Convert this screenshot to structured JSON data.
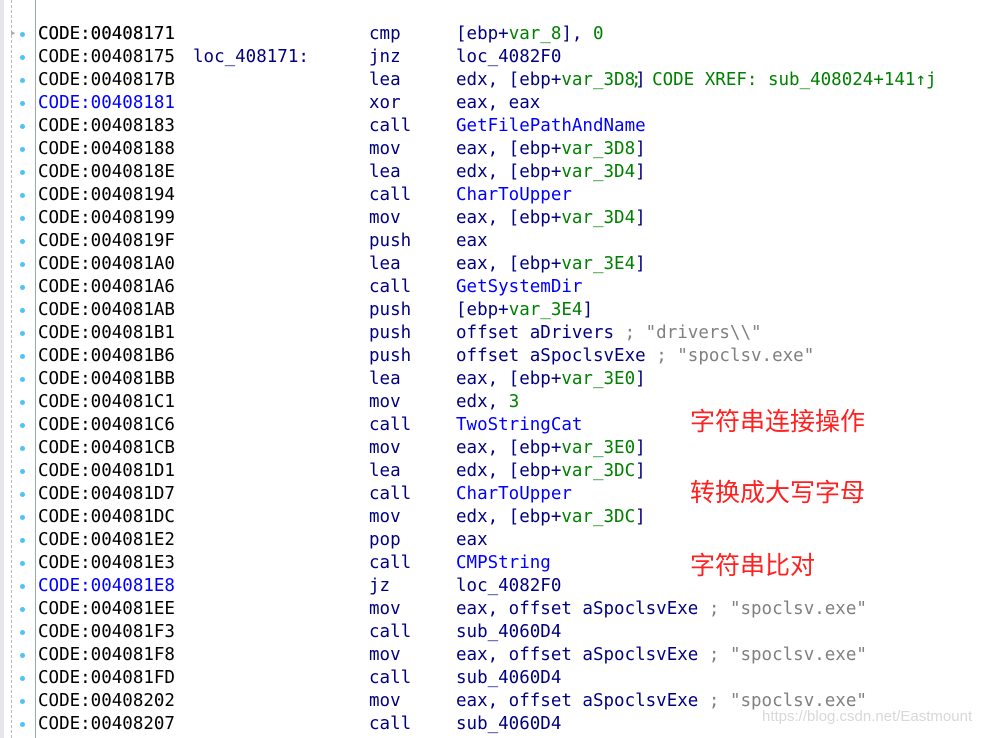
{
  "header": {
    "address": "CODE:00408171",
    "label": "loc_408171:",
    "xref": "; CODE XREF: sub_408024+141↑j"
  },
  "rows": [
    {
      "a": "CODE:00408171",
      "m": "cmp",
      "o": [
        [
          "",
          "[ebp+"
        ],
        [
          "var",
          "var_8"
        ],
        [
          "",
          "], "
        ],
        [
          "num",
          "0"
        ]
      ]
    },
    {
      "a": "CODE:00408175",
      "m": "jnz",
      "o": [
        [
          "",
          "loc_4082F0"
        ]
      ]
    },
    {
      "a": "CODE:0040817B",
      "m": "lea",
      "o": [
        [
          "",
          "edx, [ebp+"
        ],
        [
          "var",
          "var_3D8"
        ],
        [
          "",
          "]"
        ]
      ]
    },
    {
      "a": "CODE:00408181",
      "blue": true,
      "m": "xor",
      "o": [
        [
          "",
          "eax, eax"
        ]
      ]
    },
    {
      "a": "CODE:00408183",
      "m": "call",
      "o": [
        [
          "func",
          "GetFilePathAndName"
        ]
      ]
    },
    {
      "a": "CODE:00408188",
      "m": "mov",
      "o": [
        [
          "",
          "eax, [ebp+"
        ],
        [
          "var",
          "var_3D8"
        ],
        [
          "",
          "]"
        ]
      ]
    },
    {
      "a": "CODE:0040818E",
      "m": "lea",
      "o": [
        [
          "",
          "edx, [ebp+"
        ],
        [
          "var",
          "var_3D4"
        ],
        [
          "",
          "]"
        ]
      ]
    },
    {
      "a": "CODE:00408194",
      "m": "call",
      "o": [
        [
          "func",
          "CharToUpper"
        ]
      ]
    },
    {
      "a": "CODE:00408199",
      "m": "mov",
      "o": [
        [
          "",
          "eax, [ebp+"
        ],
        [
          "var",
          "var_3D4"
        ],
        [
          "",
          "]"
        ]
      ]
    },
    {
      "a": "CODE:0040819F",
      "m": "push",
      "o": [
        [
          "",
          "eax"
        ]
      ]
    },
    {
      "a": "CODE:004081A0",
      "m": "lea",
      "o": [
        [
          "",
          "eax, [ebp+"
        ],
        [
          "var",
          "var_3E4"
        ],
        [
          "",
          "]"
        ]
      ]
    },
    {
      "a": "CODE:004081A6",
      "m": "call",
      "o": [
        [
          "func",
          "GetSystemDir"
        ]
      ]
    },
    {
      "a": "CODE:004081AB",
      "m": "push",
      "o": [
        [
          "",
          "[ebp+"
        ],
        [
          "var",
          "var_3E4"
        ],
        [
          "",
          "]"
        ]
      ]
    },
    {
      "a": "CODE:004081B1",
      "m": "push",
      "o": [
        [
          "",
          "offset aDrivers "
        ],
        [
          "cmt",
          "; \"drivers\\\\\""
        ]
      ]
    },
    {
      "a": "CODE:004081B6",
      "m": "push",
      "o": [
        [
          "",
          "offset aSpoclsvExe "
        ],
        [
          "cmt",
          "; \"spoclsv.exe\""
        ]
      ]
    },
    {
      "a": "CODE:004081BB",
      "m": "lea",
      "o": [
        [
          "",
          "eax, [ebp+"
        ],
        [
          "var",
          "var_3E0"
        ],
        [
          "",
          "]"
        ]
      ]
    },
    {
      "a": "CODE:004081C1",
      "m": "mov",
      "o": [
        [
          "",
          "edx, "
        ],
        [
          "num",
          "3"
        ]
      ]
    },
    {
      "a": "CODE:004081C6",
      "m": "call",
      "o": [
        [
          "func",
          "TwoStringCat"
        ]
      ]
    },
    {
      "a": "CODE:004081CB",
      "m": "mov",
      "o": [
        [
          "",
          "eax, [ebp+"
        ],
        [
          "var",
          "var_3E0"
        ],
        [
          "",
          "]"
        ]
      ]
    },
    {
      "a": "CODE:004081D1",
      "m": "lea",
      "o": [
        [
          "",
          "edx, [ebp+"
        ],
        [
          "var",
          "var_3DC"
        ],
        [
          "",
          "]"
        ]
      ]
    },
    {
      "a": "CODE:004081D7",
      "m": "call",
      "o": [
        [
          "func",
          "CharToUpper"
        ]
      ]
    },
    {
      "a": "CODE:004081DC",
      "m": "mov",
      "o": [
        [
          "",
          "edx, [ebp+"
        ],
        [
          "var",
          "var_3DC"
        ],
        [
          "",
          "]"
        ]
      ]
    },
    {
      "a": "CODE:004081E2",
      "m": "pop",
      "o": [
        [
          "",
          "eax"
        ]
      ]
    },
    {
      "a": "CODE:004081E3",
      "m": "call",
      "o": [
        [
          "func",
          "CMPString"
        ]
      ]
    },
    {
      "a": "CODE:004081E8",
      "blue": true,
      "m": "jz",
      "o": [
        [
          "",
          "loc_4082F0"
        ]
      ]
    },
    {
      "a": "CODE:004081EE",
      "m": "mov",
      "o": [
        [
          "",
          "eax, offset aSpoclsvExe "
        ],
        [
          "cmt",
          "; \"spoclsv.exe\""
        ]
      ]
    },
    {
      "a": "CODE:004081F3",
      "m": "call",
      "o": [
        [
          "",
          "sub_4060D4"
        ]
      ]
    },
    {
      "a": "CODE:004081F8",
      "m": "mov",
      "o": [
        [
          "",
          "eax, offset aSpoclsvExe "
        ],
        [
          "cmt",
          "; \"spoclsv.exe\""
        ]
      ]
    },
    {
      "a": "CODE:004081FD",
      "m": "call",
      "o": [
        [
          "",
          "sub_4060D4"
        ]
      ]
    },
    {
      "a": "CODE:00408202",
      "m": "mov",
      "o": [
        [
          "",
          "eax, offset aSpoclsvExe "
        ],
        [
          "cmt",
          "; \"spoclsv.exe\""
        ]
      ]
    },
    {
      "a": "CODE:00408207",
      "m": "call",
      "o": [
        [
          "",
          "sub_4060D4"
        ]
      ]
    }
  ],
  "annotations": {
    "concat": "字符串连接操作",
    "upper": "转换成大写字母",
    "compare": "字符串比对"
  },
  "watermark": "https://blog.csdn.net/Eastmount",
  "colors": {
    "mnemonic": "#000080",
    "variable": "#008000",
    "function": "#0000ff",
    "comment": "#808080",
    "annotation": "#ff2020"
  }
}
